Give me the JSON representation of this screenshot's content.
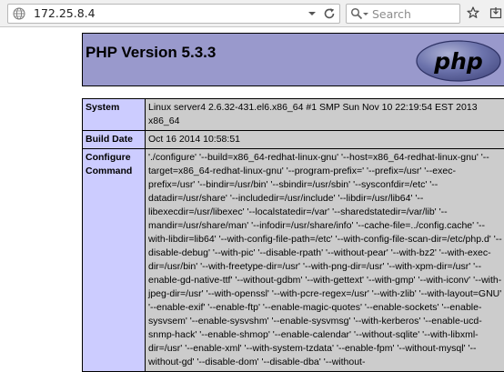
{
  "browser": {
    "url": "172.25.8.4",
    "search_placeholder": "Search"
  },
  "header": {
    "title": "PHP Version 5.3.3",
    "logo_text": "php"
  },
  "rows": [
    {
      "label": "System",
      "value": "Linux server4 2.6.32-431.el6.x86_64 #1 SMP Sun Nov 10 22:19:54 EST 2013 x86_64"
    },
    {
      "label": "Build Date",
      "value": "Oct 16 2014 10:58:51"
    },
    {
      "label": "Configure Command",
      "value": "'./configure' '--build=x86_64-redhat-linux-gnu' '--host=x86_64-redhat-linux-gnu' '--target=x86_64-redhat-linux-gnu' '--program-prefix=' '--prefix=/usr' '--exec-prefix=/usr' '--bindir=/usr/bin' '--sbindir=/usr/sbin' '--sysconfdir=/etc' '--datadir=/usr/share' '--includedir=/usr/include' '--libdir=/usr/lib64' '--libexecdir=/usr/libexec' '--localstatedir=/var' '--sharedstatedir=/var/lib' '--mandir=/usr/share/man' '--infodir=/usr/share/info' '--cache-file=../config.cache' '--with-libdir=lib64' '--with-config-file-path=/etc' '--with-config-file-scan-dir=/etc/php.d' '--disable-debug' '--with-pic' '--disable-rpath' '--without-pear' '--with-bz2' '--with-exec-dir=/usr/bin' '--with-freetype-dir=/usr' '--with-png-dir=/usr' '--with-xpm-dir=/usr' '--enable-gd-native-ttf' '--without-gdbm' '--with-gettext' '--with-gmp' '--with-iconv' '--with-jpeg-dir=/usr' '--with-openssl' '--with-pcre-regex=/usr' '--with-zlib' '--with-layout=GNU' '--enable-exif' '--enable-ftp' '--enable-magic-quotes' '--enable-sockets' '--enable-sysvsem' '--enable-sysvshm' '--enable-sysvmsg' '--with-kerberos' '--enable-ucd-snmp-hack' '--enable-shmop' '--enable-calendar' '--without-sqlite' '--with-libxml-dir=/usr' '--enable-xml' '--with-system-tzdata' '--enable-fpm' '--without-mysql' '--without-gd' '--disable-dom' '--disable-dba' '--without-"
    }
  ]
}
